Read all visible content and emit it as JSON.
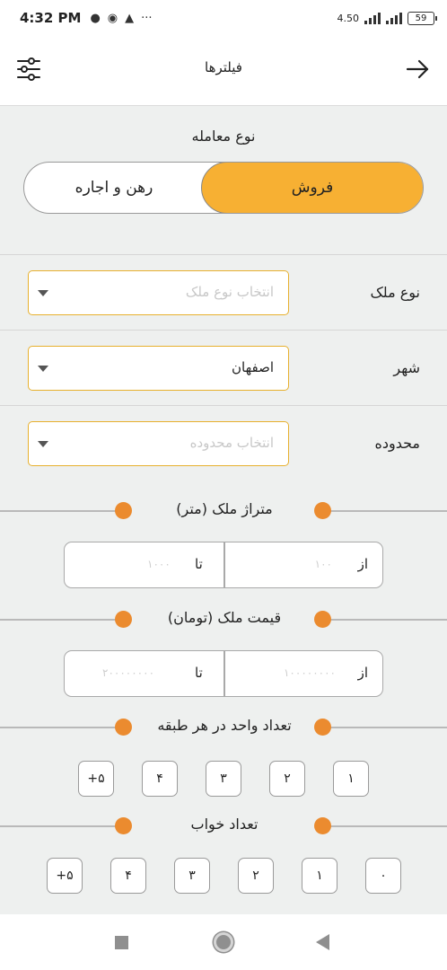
{
  "status": {
    "time": "4:32 PM",
    "net": "4.50",
    "battery": "59"
  },
  "header": {
    "title": "فیلترها"
  },
  "deal": {
    "title": "نوع معامله",
    "sell": "فروش",
    "rent": "رهن و اجاره",
    "selected": "فروش"
  },
  "fields": {
    "type": {
      "label": "نوع ملک",
      "placeholder": "انتخاب نوع ملک"
    },
    "city": {
      "label": "شهر",
      "value": "اصفهان"
    },
    "region": {
      "label": "محدوده",
      "placeholder": "انتخاب محدوده"
    }
  },
  "area": {
    "title": "متراژ ملک (متر)",
    "from_label": "از",
    "from_placeholder": "۱۰۰",
    "to_label": "تا",
    "to_placeholder": "۱۰۰۰"
  },
  "price": {
    "title": "قیمت ملک (تومان)",
    "from_label": "از",
    "from_placeholder": "۱۰۰۰۰۰۰۰۰",
    "to_label": "تا",
    "to_placeholder": "۲۰۰۰۰۰۰۰۰"
  },
  "units": {
    "title": "تعداد واحد در هر طبقه",
    "options": [
      "۱",
      "۲",
      "۳",
      "۴",
      "+۵"
    ]
  },
  "rooms": {
    "title": "تعداد خواب",
    "options": [
      "۰",
      "۱",
      "۲",
      "۳",
      "۴",
      "+۵"
    ]
  },
  "colors": {
    "accent": "#f7b033",
    "slider_dot": "#eb8b2f",
    "select_border": "#e7b02e"
  }
}
